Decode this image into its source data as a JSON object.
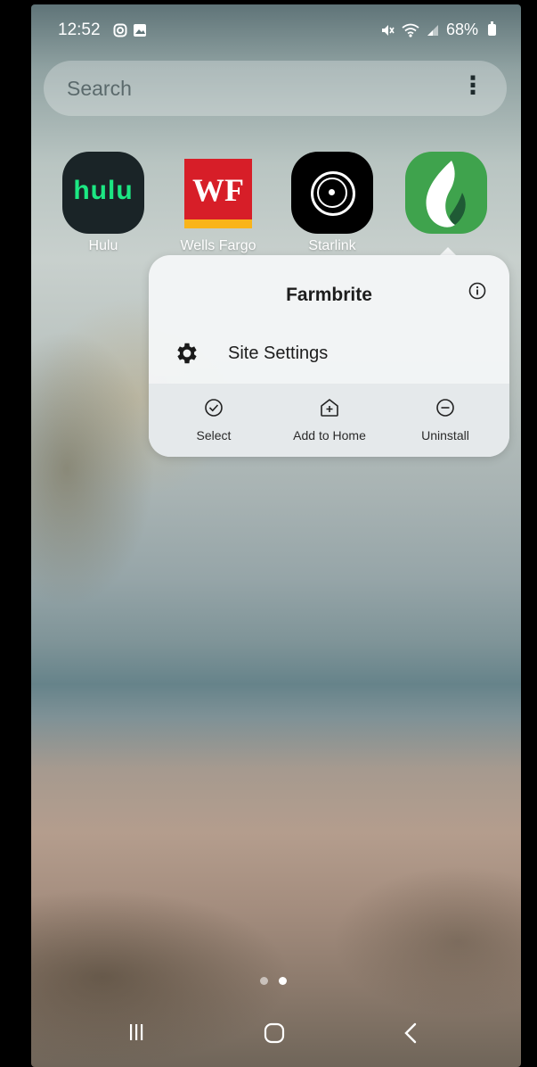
{
  "status_bar": {
    "time": "12:52",
    "battery": "68%",
    "left_icons": [
      "instagram-icon",
      "image-icon"
    ],
    "right_icons": [
      "mute-icon",
      "wifi-icon",
      "signal-icon",
      "battery-icon"
    ]
  },
  "search": {
    "placeholder": "Search",
    "menu_icon": "more-vert-icon"
  },
  "apps": [
    {
      "label": "Hulu",
      "icon_text": "hulu",
      "color": "#1ce783"
    },
    {
      "label": "Wells Fargo",
      "icon_text": "WF",
      "color": "#d71e28"
    },
    {
      "label": "Starlink",
      "color": "#000000"
    },
    {
      "label": "",
      "color": "#3fa34d"
    }
  ],
  "popup": {
    "title": "Farmbrite",
    "site_settings": "Site Settings",
    "actions": [
      {
        "label": "Select",
        "icon": "check-circle-icon"
      },
      {
        "label": "Add to Home",
        "icon": "add-home-icon"
      },
      {
        "label": "Uninstall",
        "icon": "minus-circle-icon"
      }
    ]
  },
  "page_indicator": {
    "pages": 2,
    "active": 2
  },
  "nav_bar": {
    "buttons": [
      "recents-button",
      "home-button",
      "back-button"
    ]
  }
}
